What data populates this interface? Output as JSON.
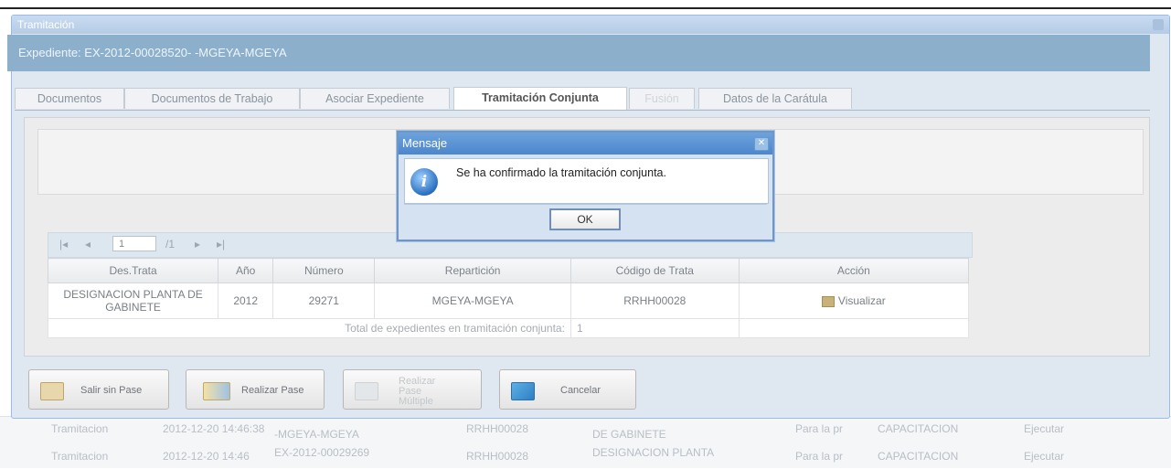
{
  "window": {
    "title": "Tramitación"
  },
  "panel": {
    "title": "Expediente: EX-2012-00028520- -MGEYA-MGEYA"
  },
  "tabs": [
    {
      "label": "Documentos"
    },
    {
      "label": "Documentos de Trabajo"
    },
    {
      "label": "Asociar Expediente"
    },
    {
      "label": "Tramitación Conjunta"
    },
    {
      "label": "Fusión"
    },
    {
      "label": "Datos de la Carátula"
    }
  ],
  "pager": {
    "first": "|◂",
    "prev": "◂",
    "page": "1",
    "of": "/1",
    "next": "▸",
    "last": "▸|"
  },
  "grid": {
    "headers": [
      "Des.Trata",
      "Año",
      "Número",
      "Repartición",
      "Código de Trata",
      "Acción"
    ],
    "rows": [
      {
        "trata": "DESIGNACION PLANTA DE GABINETE",
        "anio": "2012",
        "numero": "29271",
        "reparticion": "MGEYA-MGEYA",
        "codigo": "RRHH00028",
        "accion": "Visualizar"
      }
    ],
    "total_label": "Total de expedientes en tramitación conjunta:",
    "total_value": "1"
  },
  "buttons": {
    "salir": "Salir sin Pase",
    "realizar": "Realizar Pase",
    "multiple": "Realizar Pase Múltiple",
    "cancelar": "Cancelar"
  },
  "dialog": {
    "title": "Mensaje",
    "message": "Se ha confirmado la tramitación conjunta.",
    "ok": "OK"
  },
  "background_rows": [
    {
      "c1": "Tramitacion",
      "c2": "2012-12-20 14:46:38",
      "c3": "-MGEYA-MGEYA",
      "c4": "RRHH00028",
      "c5": "DE GABINETE",
      "c6": "Para la pr",
      "c7": "CAPACITACION",
      "c8": "Ejecutar"
    },
    {
      "c1": "Tramitacion",
      "c2": "2012-12-20 14:46",
      "c3": "EX-2012-00029269",
      "c4": "RRHH00028",
      "c5": "DESIGNACION PLANTA",
      "c6": "Para la pr",
      "c7": "CAPACITACION",
      "c8": "Ejecutar"
    }
  ]
}
